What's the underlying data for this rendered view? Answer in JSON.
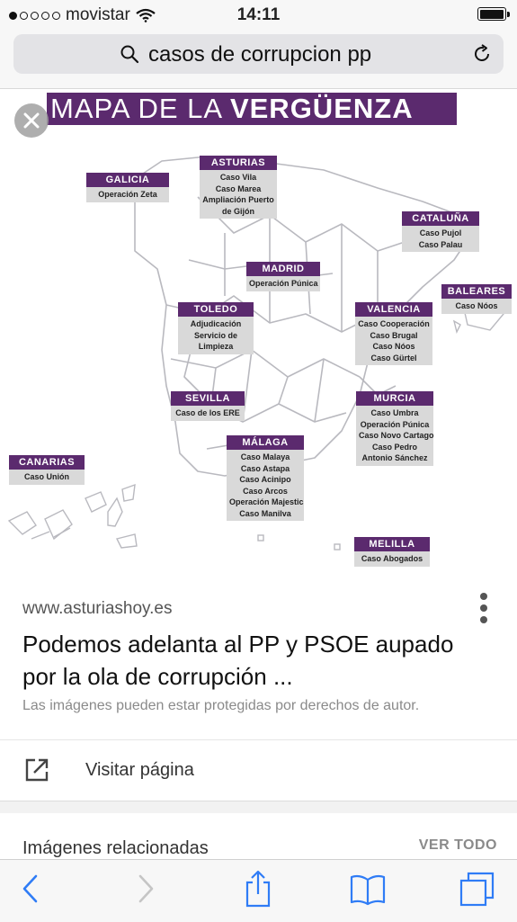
{
  "status": {
    "carrier": "movistar",
    "time": "14:11",
    "signal_dots_filled": 1,
    "signal_dots_total": 5
  },
  "search": {
    "query": "casos de corrupcion pp"
  },
  "map": {
    "title_part1": "MAPA DE LA ",
    "title_part2": "VERGÜENZA",
    "regions": [
      {
        "id": "galicia",
        "name": "GALICIA",
        "lines": [
          "Operación Zeta"
        ]
      },
      {
        "id": "asturias",
        "name": "ASTURIAS",
        "lines": [
          "Caso Vila",
          "Caso Marea",
          "Ampliación Puerto",
          "de Gijón"
        ]
      },
      {
        "id": "cataluna",
        "name": "CATALUÑA",
        "lines": [
          "Caso Pujol",
          "Caso Palau"
        ]
      },
      {
        "id": "madrid",
        "name": "MADRID",
        "lines": [
          "Operación Púnica"
        ]
      },
      {
        "id": "baleares",
        "name": "BALEARES",
        "lines": [
          "Caso Nóos"
        ]
      },
      {
        "id": "toledo",
        "name": "TOLEDO",
        "lines": [
          "Adjudicación",
          "Servicio de",
          "Limpieza"
        ]
      },
      {
        "id": "valencia",
        "name": "VALENCIA",
        "lines": [
          "Caso Cooperación",
          "Caso Brugal",
          "Caso Nóos",
          "Caso Gürtel"
        ]
      },
      {
        "id": "sevilla",
        "name": "SEVILLA",
        "lines": [
          "Caso de los ERE"
        ]
      },
      {
        "id": "murcia",
        "name": "MURCIA",
        "lines": [
          "Caso Umbra",
          "Operación Púnica",
          "Caso Novo Cartago",
          "Caso Pedro",
          "Antonio Sánchez"
        ]
      },
      {
        "id": "malaga",
        "name": "MÁLAGA",
        "lines": [
          "Caso Malaya",
          "Caso Astapa",
          "Caso Acinipo",
          "Caso Arcos",
          "Operación Majestic",
          "Caso Manilva"
        ]
      },
      {
        "id": "canarias",
        "name": "CANARIAS",
        "lines": [
          "Caso Unión"
        ]
      },
      {
        "id": "melilla",
        "name": "MELILLA",
        "lines": [
          "Caso Abogados"
        ]
      }
    ]
  },
  "result": {
    "domain": "www.asturiashoy.es",
    "headline": "Podemos adelanta al PP y PSOE aupado por la ola de corrupción ...",
    "copyright": "Las imágenes pueden estar protegidas por derechos de autor.",
    "visit_label": "Visitar página"
  },
  "related": {
    "title": "Imágenes relacionadas",
    "see_all": "VER TODO"
  },
  "colors": {
    "accent": "#5b2a6e",
    "tint": "#2f7cf6",
    "disabled": "#c5c5c5"
  },
  "icons": [
    "wifi-icon",
    "battery-icon",
    "search-icon",
    "reload-icon",
    "close-icon",
    "more-vertical-icon",
    "external-link-icon",
    "back-icon",
    "forward-icon",
    "share-icon",
    "bookmarks-icon",
    "tabs-icon"
  ]
}
